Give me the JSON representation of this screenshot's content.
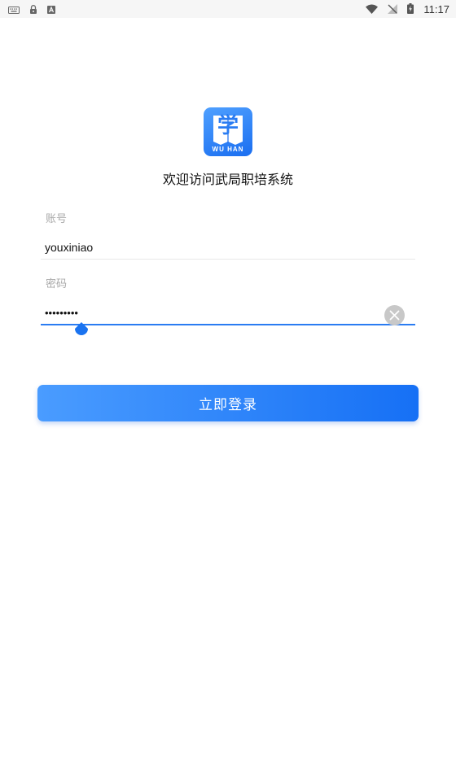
{
  "status_bar": {
    "time": "11:17",
    "left_icons": [
      "keyboard-icon",
      "lock-icon",
      "text-a-icon"
    ],
    "right_icons": [
      "wifi-icon",
      "no-signal-icon",
      "battery-charging-icon"
    ]
  },
  "logo": {
    "glyph": "学",
    "caption": "WU HAN",
    "color": "#2a7cf2"
  },
  "welcome_text": "欢迎访问武局职培系统",
  "account": {
    "label": "账号",
    "value": "youxiniao"
  },
  "password": {
    "label": "密码",
    "value": "youxiniao"
  },
  "login_button": {
    "label": "立即登录"
  },
  "colors": {
    "accent": "#2a7cf2",
    "label_gray": "#a9a9a9"
  }
}
